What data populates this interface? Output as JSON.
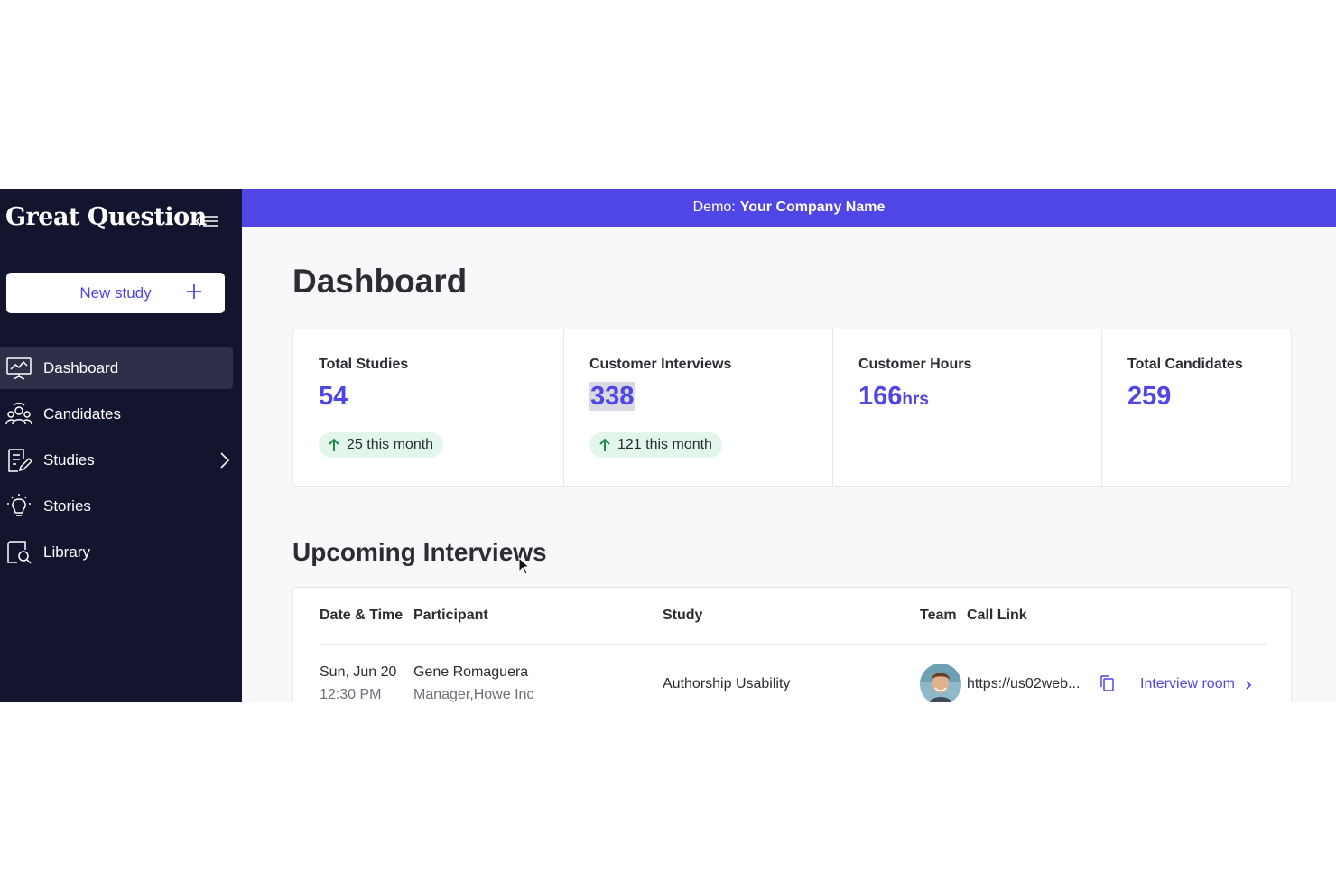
{
  "sidebar": {
    "brand": "Great Question",
    "new_study_label": "New study",
    "items": [
      {
        "label": "Dashboard",
        "icon": "dashboard-icon",
        "active": true
      },
      {
        "label": "Candidates",
        "icon": "candidates-icon"
      },
      {
        "label": "Studies",
        "icon": "studies-icon"
      },
      {
        "label": "Stories",
        "icon": "lightbulb-icon"
      },
      {
        "label": "Library",
        "icon": "library-icon"
      }
    ]
  },
  "banner": {
    "prefix": "Demo:",
    "company": "Your Company Name"
  },
  "page": {
    "title": "Dashboard"
  },
  "stats": [
    {
      "label": "Total Studies",
      "value": "54",
      "delta": "25 this month"
    },
    {
      "label": "Customer Interviews",
      "value": "338",
      "delta": "121 this month"
    },
    {
      "label": "Customer Hours",
      "value": "166",
      "unit": "hrs"
    },
    {
      "label": "Total Candidates",
      "value": "259"
    }
  ],
  "interviews": {
    "title": "Upcoming Interviews",
    "columns": [
      "Date & Time",
      "Participant",
      "Study",
      "Team",
      "Call Link"
    ],
    "rows": [
      {
        "date": "Sun, Jun 20",
        "time": "12:30 PM",
        "participant": "Gene Romaguera",
        "participant_role": "Manager,Howe Inc",
        "study": "Authorship Usability",
        "call_link": "https://us02web...",
        "room_label": "Interview room"
      }
    ]
  },
  "colors": {
    "sidebar_bg": "#13142e",
    "accent": "#4f46e5",
    "delta_bg": "#e3f6ec",
    "delta_arrow": "#1f8a4c"
  }
}
